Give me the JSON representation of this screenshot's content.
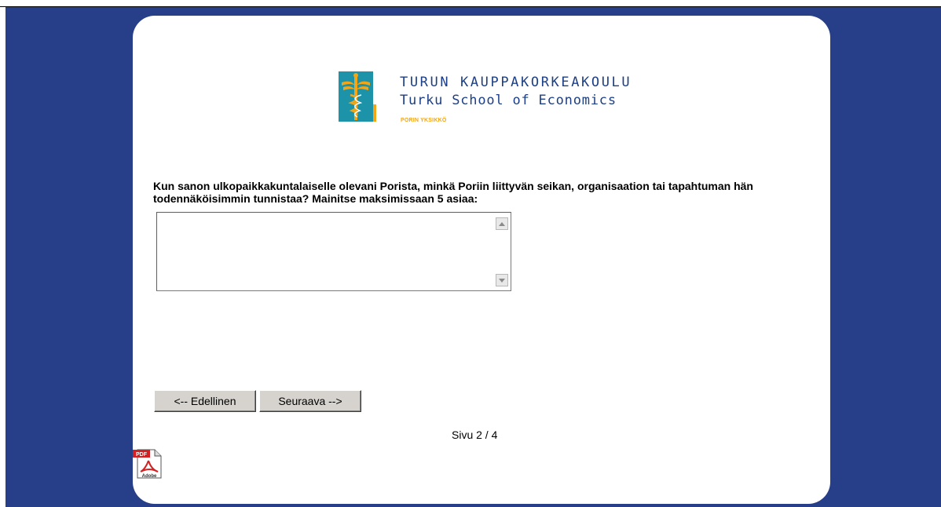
{
  "logo": {
    "title": "TURUN KAUPPAKORKEAKOULU",
    "subtitle": "Turku School of Economics",
    "unit": "PORIN YKSIKKÖ",
    "colors": {
      "teal": "#1c93a8",
      "gold": "#f2a516",
      "navy": "#1c3f86"
    }
  },
  "question": {
    "text": "Kun sanon ulkopaikkakuntalaiselle olevani Porista, minkä Poriin liittyvän seikan, organisaation tai tapahtuman hän todennäköisimmin tunnistaa? Mainitse maksimissaan 5 asiaa:",
    "answer_value": ""
  },
  "navigation": {
    "prev_label": "<-- Edellinen",
    "next_label": "Seuraava -->",
    "page_indicator": "Sivu 2 / 4"
  },
  "pdf_icon": {
    "badge": "PDF",
    "label": "Adobe",
    "icon": "pdf-icon"
  },
  "colors": {
    "background": "#263f88",
    "card": "#ffffff",
    "button_face": "#d6d3ce"
  }
}
